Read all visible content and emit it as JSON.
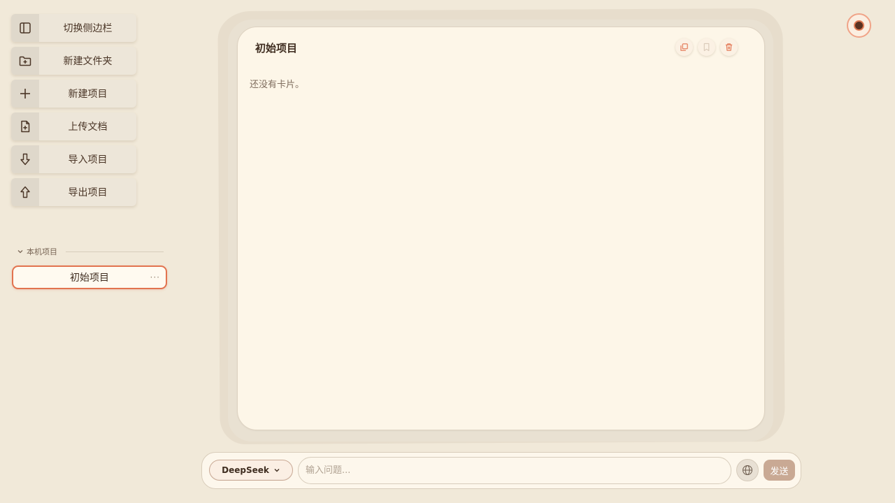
{
  "sidebar": {
    "actions": [
      {
        "label": "切换侧边栏",
        "icon": "sidebar-toggle-icon"
      },
      {
        "label": "新建文件夹",
        "icon": "folder-plus-icon"
      },
      {
        "label": "新建项目",
        "icon": "plus-icon"
      },
      {
        "label": "上传文档",
        "icon": "file-plus-icon"
      },
      {
        "label": "导入项目",
        "icon": "arrow-down-icon"
      },
      {
        "label": "导出项目",
        "icon": "arrow-up-icon"
      }
    ],
    "local_section": {
      "title": "本机项目",
      "projects": [
        {
          "name": "初始项目",
          "more": "···"
        }
      ]
    }
  },
  "main": {
    "title": "初始项目",
    "empty_text": "还没有卡片。",
    "tools": [
      "copy-icon",
      "bookmark-icon",
      "trash-icon"
    ]
  },
  "chat": {
    "model": "DeepSeek",
    "placeholder": "输入问题...",
    "send_label": "发送"
  },
  "colors": {
    "background": "#f1e9d9",
    "accent": "#e2734f",
    "card": "#fdf6e8",
    "text": "#4a3526",
    "send_button": "#c9a994"
  }
}
